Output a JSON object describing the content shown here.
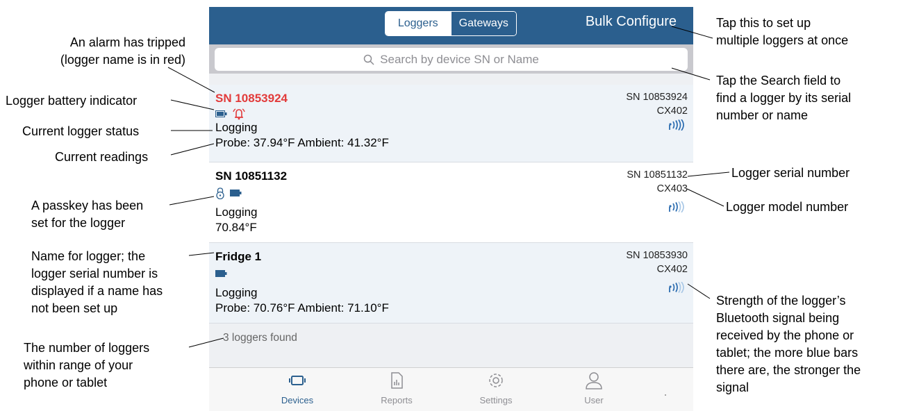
{
  "toolbar": {
    "segment_loggers": "Loggers",
    "segment_gateways": "Gateways",
    "bulk_configure": "Bulk Configure"
  },
  "search": {
    "placeholder": "Search by device SN or Name"
  },
  "loggers": [
    {
      "name": "SN 10853924",
      "alarm": true,
      "passkey": false,
      "status": "Logging",
      "reading": "Probe: 37.94°F Ambient: 41.32°F",
      "sn": "SN 10853924",
      "model": "CX402",
      "signal_bars": 4,
      "battery_icon": "battery-icon",
      "alarm_icon": "alarm-bell-icon"
    },
    {
      "name": "SN 10851132",
      "alarm": false,
      "passkey": true,
      "status": "Logging",
      "reading": "70.84°F",
      "sn": "SN 10851132",
      "model": "CX403",
      "signal_bars": 2,
      "battery_icon": "battery-icon",
      "passkey_icon": "lock-icon"
    },
    {
      "name": "Fridge 1",
      "alarm": false,
      "passkey": false,
      "status": "Logging",
      "reading": "Probe: 70.76°F Ambient: 71.10°F",
      "sn": "SN 10853930",
      "model": "CX402",
      "signal_bars": 2,
      "battery_icon": "battery-icon"
    }
  ],
  "list_footer": {
    "found": "3 loggers found"
  },
  "tabs": [
    {
      "label": "Devices",
      "icon": "device-icon",
      "active": true
    },
    {
      "label": "Reports",
      "icon": "report-icon",
      "active": false
    },
    {
      "label": "Settings",
      "icon": "gear-icon",
      "active": false
    },
    {
      "label": "User",
      "icon": "user-icon",
      "active": false
    }
  ],
  "callouts": {
    "alarm": [
      "An alarm has tripped",
      "(logger name is in red)"
    ],
    "battery": "Logger battery indicator",
    "status": "Current logger status",
    "readings": "Current readings",
    "passkey": [
      "A passkey has been",
      "set for the logger"
    ],
    "name": [
      "Name for logger; the",
      "logger serial number is",
      "displayed if a name has",
      "not been set up"
    ],
    "count": [
      "The number of loggers",
      "within range of your",
      "phone or tablet"
    ],
    "bulk": [
      "Tap this to set up",
      "multiple loggers at once"
    ],
    "search": [
      "Tap the Search field to",
      "find a logger by its serial",
      "number or name"
    ],
    "serial": "Logger serial number",
    "model": "Logger model number",
    "signal": [
      "Strength of the logger’s",
      "Bluetooth signal being",
      "received by the phone or",
      "tablet; the more blue bars",
      "there are, the stronger the",
      "signal"
    ]
  },
  "colors": {
    "header_blue": "#2b5f8e",
    "alarm_red": "#e23b3b",
    "signal_blue": "#2b6cb0",
    "signal_light": "#a9c8e6"
  }
}
